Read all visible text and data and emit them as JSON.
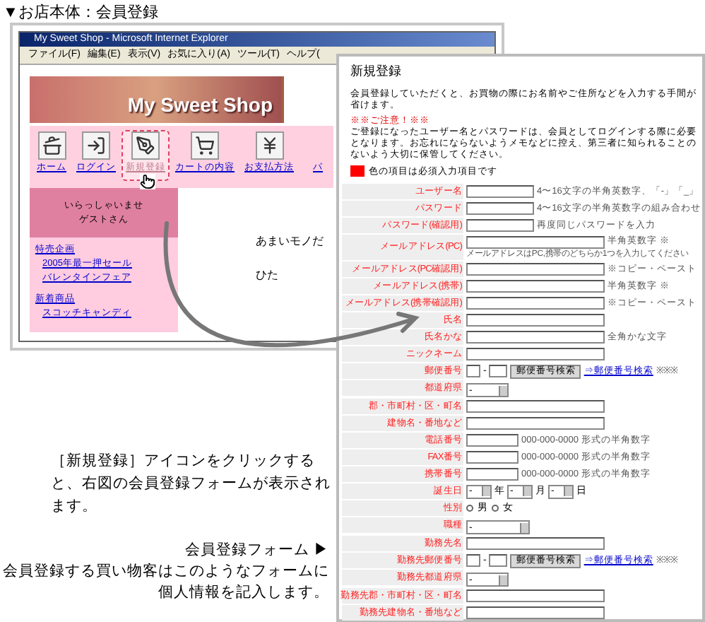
{
  "page_heading": "▼お店本体：会員登録",
  "browser": {
    "title": "My Sweet Shop - Microsoft Internet Explorer",
    "menu": [
      "ファイル(F)",
      "編集(E)",
      "表示(V)",
      "お気に入り(A)",
      "ツール(T)",
      "ヘルプ("
    ],
    "banner": "My Sweet Shop",
    "nav": [
      {
        "label": "ホーム",
        "kind": "home",
        "selected": false
      },
      {
        "label": "ログイン",
        "kind": "login",
        "selected": false
      },
      {
        "label": "新規登録",
        "kind": "register",
        "selected": true
      },
      {
        "label": "カートの内容",
        "kind": "cart",
        "selected": false
      },
      {
        "label": "お支払方法",
        "kind": "payment",
        "selected": false
      },
      {
        "label": "パ",
        "kind": "none",
        "selected": false
      }
    ],
    "greeting": [
      "いらっしゃいませ",
      "ゲストさん"
    ],
    "sections": [
      {
        "title": "特売企画",
        "links": [
          "2005年最一押セール",
          "バレンタインフェア"
        ]
      },
      {
        "title": "新着商品",
        "links": [
          "スコッチキャンディ"
        ]
      }
    ],
    "content_text": [
      "あまいモノだ",
      "ひた"
    ]
  },
  "caption_click": "［新規登録］アイコンをクリックすると、右図の会員登録フォームが表示されます。",
  "caption_form_title": "会員登録フォーム ▶",
  "caption_form": "会員登録する買い物客はこのようなフォームに個人情報を記入します。",
  "form": {
    "title": "新規登録",
    "intro": "会員登録していただくと、お買物の際にお名前やご住所などを入力する手間が省けます。",
    "notice_heading": "※※ご注意！※※",
    "notice": "ご登録になったユーザー名とパスワードは、会員としてログインする際に必要となります。お忘れにならないようメモなどに控え、第三者に知られることのないよう大切に保管してください。",
    "legend": "色の項目は必須入力項目です",
    "rows": [
      {
        "label": "ユーザー名",
        "kind": "medium",
        "hint": "4〜16文字の半角英数字、「-」「_」"
      },
      {
        "label": "パスワード",
        "kind": "medium",
        "hint": "4〜16文字の半角英数字の組み合わせ"
      },
      {
        "label": "パスワード(確認用)",
        "kind": "medium",
        "hint": "再度同じパスワードを入力"
      },
      {
        "label": "メールアドレス(PC)",
        "kind": "long",
        "hint": "半角英数字 ※",
        "note": "メールアドレスはPC,携帯のどちらか1つを入力してください"
      },
      {
        "label": "メールアドレス(PC確認用)",
        "kind": "long",
        "hint": "※コピー・ペースト"
      },
      {
        "label": "メールアドレス(携帯)",
        "kind": "long",
        "hint": "半角英数字 ※"
      },
      {
        "label": "メールアドレス(携帯確認用)",
        "kind": "long",
        "hint": "※コピー・ペースト"
      },
      {
        "label": "氏名",
        "kind": "long"
      },
      {
        "label": "氏名かな",
        "kind": "long",
        "hint": "全角かな文字"
      },
      {
        "label": "ニックネーム",
        "kind": "long"
      },
      {
        "label": "郵便番号",
        "kind": "zip",
        "separator": "-",
        "button": "郵便番号検索",
        "link": "⇒郵便番号検索",
        "mark": "※※※"
      },
      {
        "label": "都道府県",
        "kind": "select",
        "value": "-"
      },
      {
        "label": "郡・市町村・区・町名",
        "kind": "long"
      },
      {
        "label": "建物名・番地など",
        "kind": "long"
      },
      {
        "label": "電話番号",
        "kind": "short",
        "hint": "000-000-0000 形式の半角数字"
      },
      {
        "label": "FAX番号",
        "kind": "short",
        "hint": "000-000-0000 形式の半角数字"
      },
      {
        "label": "携帯番号",
        "kind": "short",
        "hint": "000-000-0000 形式の半角数字"
      },
      {
        "label": "誕生日",
        "kind": "birthday",
        "selects": [
          {
            "value": "-",
            "unit": "年"
          },
          {
            "value": "-",
            "unit": "月"
          },
          {
            "value": "-",
            "unit": "日"
          }
        ]
      },
      {
        "label": "性別",
        "kind": "radio",
        "options": [
          {
            "label": "男",
            "selected": false
          },
          {
            "label": "女",
            "selected": false
          }
        ]
      },
      {
        "label": "職種",
        "kind": "select_wide",
        "value": "-"
      },
      {
        "label": "勤務先名",
        "kind": "long"
      },
      {
        "label": "勤務先郵便番号",
        "kind": "zip",
        "separator": "-",
        "button": "郵便番号検索",
        "link": "⇒郵便番号検索",
        "mark": "※※※"
      },
      {
        "label": "勤務先都道府県",
        "kind": "select",
        "value": "-"
      },
      {
        "label": "勤務先郡・市町村・区・町名",
        "kind": "long"
      },
      {
        "label": "勤務先建物名・番地など",
        "kind": "long"
      }
    ]
  }
}
